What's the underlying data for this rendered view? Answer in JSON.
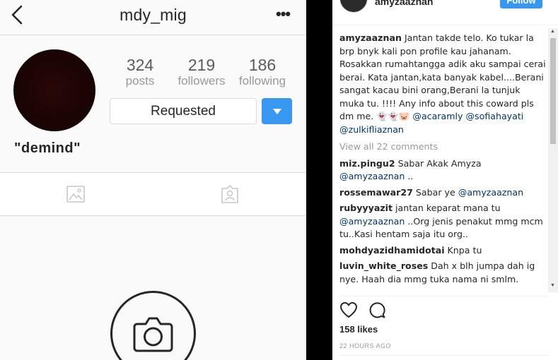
{
  "profile": {
    "username": "mdy_mig",
    "full_name": "\"demind\"",
    "stats": [
      {
        "num": "324",
        "label": "posts"
      },
      {
        "num": "219",
        "label": "followers"
      },
      {
        "num": "186",
        "label": "following"
      }
    ],
    "request_label": "Requested",
    "more_label": "•••",
    "accent": "#3897f0"
  },
  "post": {
    "author": "amyzaaznan",
    "follow_label": "Follow",
    "caption": {
      "user": "amyzaaznan",
      "text": "Jantan takde telo. Ko tukar la brp bnyk kali pon profile kau jahanam. Rosakkan rumahtangga adik aku sampai cerai berai. Kata jantan,kata banyak kabel....Berani sangat kacau bini orang,Berani la tunjuk muka tu. !!!! Any info about this coward pls dm me. 👻👻🐷",
      "mentions": [
        "@acaramly",
        "@sofiahayati",
        "@zulkifliaznan"
      ]
    },
    "view_all": "View all 22 comments",
    "comments": [
      {
        "user": "miz.pingu2",
        "text": "Sabar Akak Amyza",
        "mention": "@amyzaaznan",
        "after": " .."
      },
      {
        "user": "rossemawar27",
        "text": "Sabar ye",
        "mention": "@amyzaaznan",
        "after": ""
      },
      {
        "user": "rubyyyazit",
        "text": "jantan keparat mana tu",
        "mention": "@amyzaaznan",
        "after": " ..Org jenis penakut mmg mcm tu..Kasi hentam saja itu org.."
      },
      {
        "user": "mohdyazidhamidotai",
        "text": "Knpa tu",
        "mention": "",
        "after": ""
      },
      {
        "user": "luvin_white_roses",
        "text": "Dah x blh jumpa dah ig nye. Haah dia mmg tuka nama ni smlm.",
        "mention": "",
        "after": ""
      }
    ],
    "likes": "158 likes",
    "time_ago": "22 HOURS AGO"
  },
  "icons": [
    "back-icon",
    "more-icon",
    "dropdown-arrow-icon",
    "grid-photo-icon",
    "tagged-icon",
    "camera-icon",
    "heart-icon",
    "comment-icon"
  ]
}
